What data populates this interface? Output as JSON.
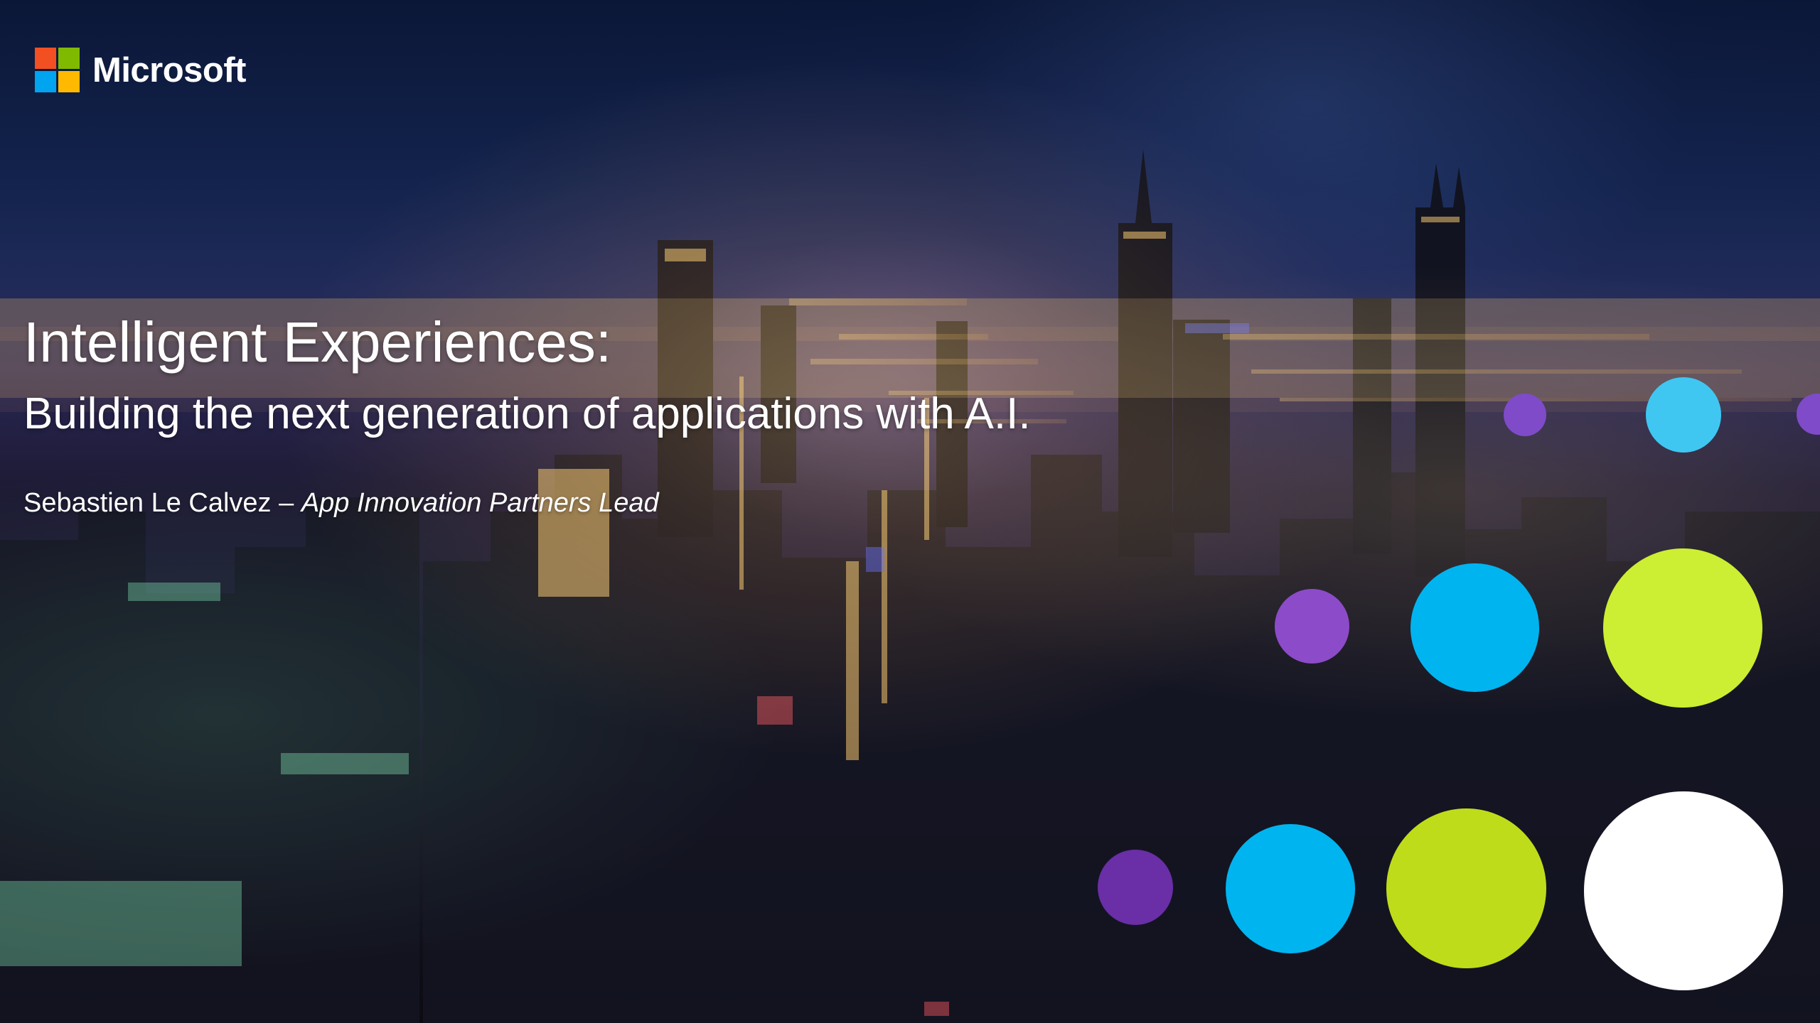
{
  "slide": {
    "brand": {
      "logo_text": "Microsoft",
      "logo_colors": [
        "#f25022",
        "#7fba00",
        "#00a4ef",
        "#ffb900"
      ]
    },
    "title": "Intelligent Experiences:",
    "subtitle": "Building the next generation of applications with A.I.",
    "presenter": {
      "name": "Sebastien Le Calvez",
      "separator": "–",
      "role": "App Innovation Partners Lead"
    },
    "decor": {
      "circle_colors": {
        "purple": "#7f4bc8",
        "cyan": "#00b4f0",
        "lime": "#bfdc1a",
        "white": "#ffffff"
      }
    }
  }
}
